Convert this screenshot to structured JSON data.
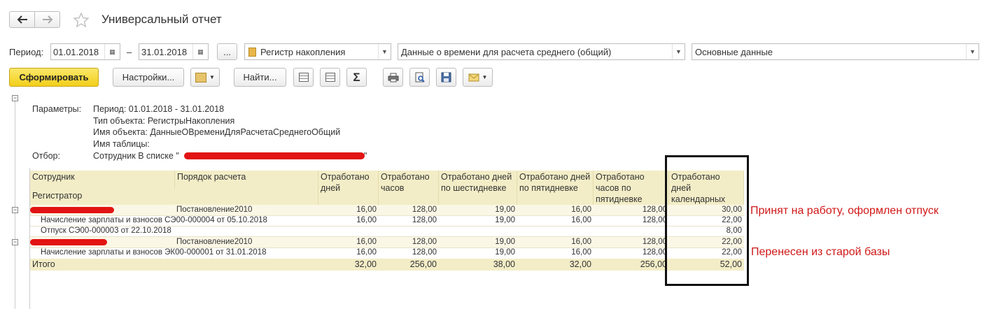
{
  "window": {
    "title": "Универсальный отчет"
  },
  "toolbar": {
    "period_label": "Период:",
    "date_from": "01.01.2018",
    "dash": "–",
    "date_to": "31.01.2018",
    "more_label": "...",
    "object_type": "Регистр накопления",
    "object_name": "Данные о времени для расчета среднего (общий)",
    "variant": "Основные данные",
    "generate_label": "Сформировать",
    "settings_label": "Настройки...",
    "find_label": "Найти...",
    "sum_symbol": "Σ"
  },
  "params": {
    "params_label": "Параметры:",
    "period": "Период: 01.01.2018 - 31.01.2018",
    "object_type": "Тип объекта: РегистрыНакопления",
    "object_name": "Имя объекта: ДанныеОВремениДляРасчетаСреднегоОбщий",
    "table_name": "Имя таблицы:",
    "filter_label": "Отбор:",
    "filter_value": "Сотрудник В списке \"",
    "filter_end": "\""
  },
  "table": {
    "headers": {
      "employee": "Сотрудник",
      "registrator": "Регистратор",
      "calc_order": "Порядок расчета",
      "days": "Отработано дней",
      "hours": "Отработано часов",
      "days6": "Отработано дней по шестидневке",
      "days5": "Отработано дней по пятидневке",
      "hours5": "Отработано часов по пятидневке",
      "caldays": "Отработано дней календарных"
    },
    "rows": [
      {
        "name": "",
        "order": "Постановление2010",
        "days": "16,00",
        "hours": "128,00",
        "days6": "19,00",
        "days5": "16,00",
        "hours5": "128,00",
        "cal": "30,00"
      },
      {
        "name": "Начисление зарплаты и взносов СЭ00-000004 от 05.10.2018",
        "order": "",
        "days": "16,00",
        "hours": "128,00",
        "days6": "19,00",
        "days5": "16,00",
        "hours5": "128,00",
        "cal": "22,00"
      },
      {
        "name": "Отпуск СЭ00-000003 от 22.10.2018",
        "order": "",
        "days": "",
        "hours": "",
        "days6": "",
        "days5": "",
        "hours5": "",
        "cal": "8,00"
      },
      {
        "name": "",
        "order": "Постановление2010",
        "days": "16,00",
        "hours": "128,00",
        "days6": "19,00",
        "days5": "16,00",
        "hours5": "128,00",
        "cal": "22,00"
      },
      {
        "name": "Начисление зарплаты и взносов ЭК00-000001 от 31.01.2018",
        "order": "",
        "days": "16,00",
        "hours": "128,00",
        "days6": "19,00",
        "days5": "16,00",
        "hours5": "128,00",
        "cal": "22,00"
      }
    ],
    "total": {
      "label": "Итого",
      "days": "32,00",
      "hours": "256,00",
      "days6": "38,00",
      "days5": "32,00",
      "hours5": "256,00",
      "cal": "52,00"
    }
  },
  "annotations": {
    "note1": "Принят на работу, оформлен отпуск",
    "note2": "Перенесен из старой базы"
  }
}
